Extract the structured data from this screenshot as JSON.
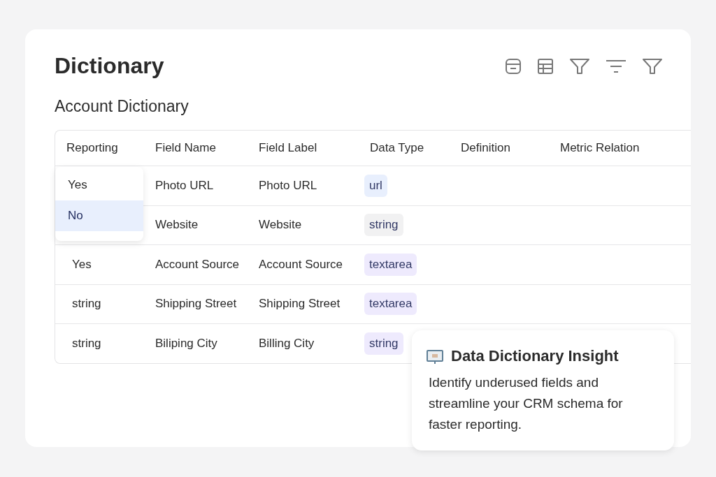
{
  "page": {
    "title": "Dictionary"
  },
  "toolbar": [
    {
      "kind": "card"
    },
    {
      "kind": "table"
    },
    {
      "kind": "funnel"
    },
    {
      "kind": "sort"
    },
    {
      "kind": "funnel"
    }
  ],
  "section": {
    "title": "Account Dictionary"
  },
  "table": {
    "columns": [
      "Reporting",
      "Field Name",
      "Field Label",
      "Data Type",
      "Definition",
      "Metric Relation"
    ],
    "rows": [
      {
        "reporting": "",
        "field_name": "Photo URL",
        "field_label": "Photo URL",
        "data_type": "url",
        "color": "#e8effd"
      },
      {
        "reporting": "",
        "field_name": "Website",
        "field_label": "Website",
        "data_type": "string",
        "color": "#f1f1f2"
      },
      {
        "reporting": "Yes",
        "field_name": "Account Source",
        "field_label": "Account Source",
        "data_type": "textarea",
        "color": "#eeeafd"
      },
      {
        "reporting": "string",
        "field_name": "Shipping Street",
        "field_label": "Shipping Street",
        "data_type": "textarea",
        "color": "#eeeafd"
      },
      {
        "reporting": "string",
        "field_name": "Biliping City",
        "field_label": "Billing City",
        "data_type": "string",
        "color": "#eeeafd"
      }
    ]
  },
  "dropdown": {
    "options": [
      {
        "label": "Yes",
        "selected": false
      },
      {
        "label": "No",
        "selected": true
      }
    ]
  },
  "insight": {
    "title": "Data Dictionary Insight",
    "text": "Identify underused fields and streamline your CRM schema for faster reporting."
  }
}
